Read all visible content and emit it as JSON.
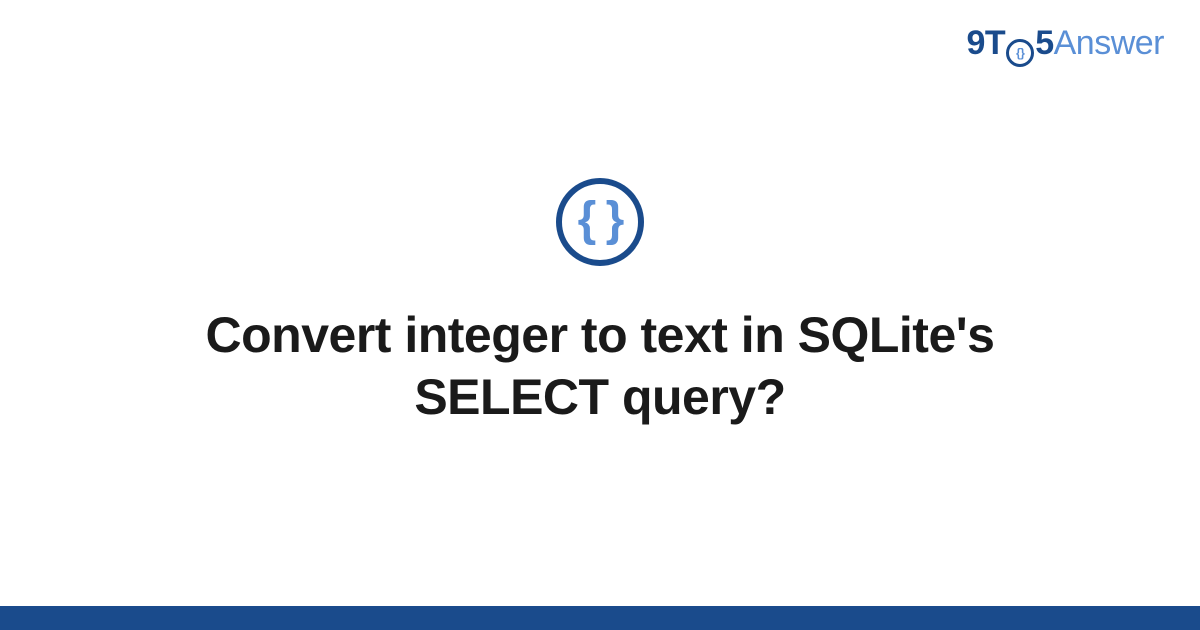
{
  "brand": {
    "part_9t": "9T",
    "part_5": "5",
    "part_answer": "Answer",
    "o_inner_glyph": "{}"
  },
  "badge": {
    "glyph": "{ }",
    "semantic_name": "code-braces-icon"
  },
  "question": {
    "title": "Convert integer to text in SQLite's SELECT query?"
  },
  "colors": {
    "brand_dark": "#1a4b8c",
    "brand_light": "#5a8fd6",
    "text": "#1a1a1a",
    "background": "#ffffff"
  }
}
